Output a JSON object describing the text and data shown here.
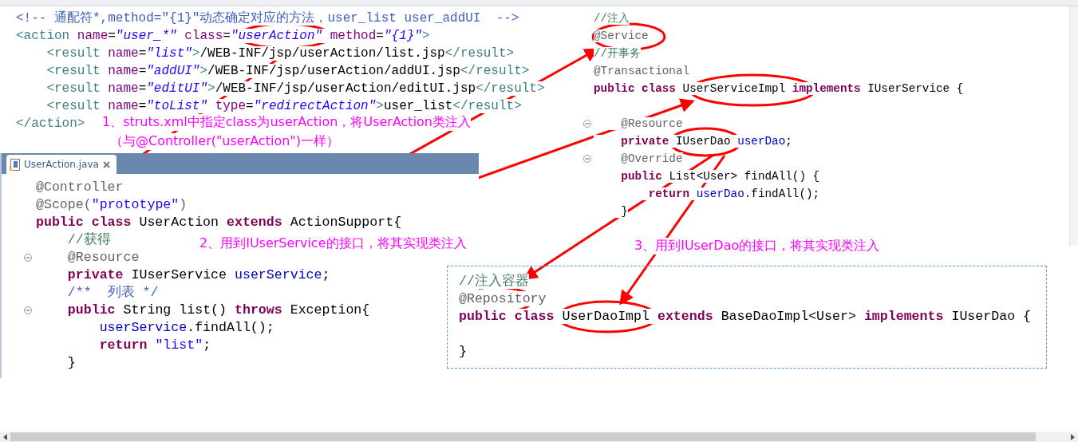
{
  "struts_snippet": {
    "lines": [
      {
        "tokens": [
          {
            "kind": "xml-comment",
            "text": "<!-- 通配符*,method=\"{1}\"动态确定对应的方法，user_list user_addUI  -->"
          }
        ]
      },
      {
        "tokens": [
          {
            "kind": "tag",
            "text": "<action"
          },
          {
            "kind": "attr",
            "text": " name"
          },
          {
            "kind": "plain",
            "text": "="
          },
          {
            "kind": "value",
            "text": "\"user_*\""
          },
          {
            "kind": "attr",
            "text": " class"
          },
          {
            "kind": "plain",
            "text": "="
          },
          {
            "kind": "value",
            "text": "\"userAction\""
          },
          {
            "kind": "attr",
            "text": " method"
          },
          {
            "kind": "plain",
            "text": "="
          },
          {
            "kind": "value",
            "text": "\"{1}\""
          },
          {
            "kind": "tag",
            "text": ">"
          }
        ]
      },
      {
        "tokens": [
          {
            "kind": "tag",
            "text": "    <result"
          },
          {
            "kind": "attr",
            "text": " name"
          },
          {
            "kind": "plain",
            "text": "="
          },
          {
            "kind": "value",
            "text": "\"list\""
          },
          {
            "kind": "tag",
            "text": ">"
          },
          {
            "kind": "plain",
            "text": "/WEB-INF/jsp/userAction/list.jsp"
          },
          {
            "kind": "tag",
            "text": "</result>"
          }
        ]
      },
      {
        "tokens": [
          {
            "kind": "tag",
            "text": "    <result"
          },
          {
            "kind": "attr",
            "text": " name"
          },
          {
            "kind": "plain",
            "text": "="
          },
          {
            "kind": "value",
            "text": "\"addUI\""
          },
          {
            "kind": "tag",
            "text": ">"
          },
          {
            "kind": "plain",
            "text": "/WEB-INF/jsp/userAction/addUI.jsp"
          },
          {
            "kind": "tag",
            "text": "</result>"
          }
        ]
      },
      {
        "tokens": [
          {
            "kind": "tag",
            "text": "    <result"
          },
          {
            "kind": "attr",
            "text": " name"
          },
          {
            "kind": "plain",
            "text": "="
          },
          {
            "kind": "value",
            "text": "\"editUI\""
          },
          {
            "kind": "tag",
            "text": ">"
          },
          {
            "kind": "plain",
            "text": "/WEB-INF/jsp/userAction/editUI.jsp"
          },
          {
            "kind": "tag",
            "text": "</result>"
          }
        ]
      },
      {
        "tokens": [
          {
            "kind": "tag",
            "text": "    <result"
          },
          {
            "kind": "attr",
            "text": " name"
          },
          {
            "kind": "plain",
            "text": "="
          },
          {
            "kind": "value",
            "text": "\"toList\""
          },
          {
            "kind": "attr",
            "text": " type"
          },
          {
            "kind": "plain",
            "text": "="
          },
          {
            "kind": "value",
            "text": "\"redirectAction\""
          },
          {
            "kind": "tag",
            "text": ">"
          },
          {
            "kind": "plain",
            "text": "user_list"
          },
          {
            "kind": "tag",
            "text": "</result>"
          }
        ]
      },
      {
        "tokens": [
          {
            "kind": "tag",
            "text": "</action>"
          }
        ]
      }
    ]
  },
  "service_snippet": {
    "lines": [
      {
        "fold": false,
        "tokens": [
          {
            "kind": "comment",
            "text": "//注入"
          }
        ]
      },
      {
        "fold": false,
        "tokens": [
          {
            "kind": "annotation",
            "text": "@Service"
          }
        ]
      },
      {
        "fold": false,
        "tokens": [
          {
            "kind": "comment",
            "text": "//开事务"
          }
        ]
      },
      {
        "fold": false,
        "tokens": [
          {
            "kind": "annotation",
            "text": "@Transactional"
          }
        ]
      },
      {
        "fold": false,
        "tokens": [
          {
            "kind": "keyword",
            "text": "public class"
          },
          {
            "kind": "plain",
            "text": " UserServiceImpl "
          },
          {
            "kind": "keyword",
            "text": "implements"
          },
          {
            "kind": "plain",
            "text": " IUserService {"
          }
        ]
      },
      {
        "fold": false
      },
      {
        "fold": true,
        "tokens": [
          {
            "kind": "annotation",
            "text": "    @Resource"
          }
        ]
      },
      {
        "fold": false,
        "tokens": [
          {
            "kind": "keyword",
            "text": "    private"
          },
          {
            "kind": "plain",
            "text": " IUserDao "
          },
          {
            "kind": "field",
            "text": "userDao"
          },
          {
            "kind": "plain",
            "text": ";"
          }
        ]
      },
      {
        "fold": true,
        "tokens": [
          {
            "kind": "annotation",
            "text": "    @Override"
          }
        ]
      },
      {
        "fold": false,
        "tokens": [
          {
            "kind": "keyword",
            "text": "    public"
          },
          {
            "kind": "plain",
            "text": " List<User> findAll() {"
          }
        ]
      },
      {
        "fold": false,
        "tokens": [
          {
            "kind": "keyword",
            "text": "        return"
          },
          {
            "kind": "field",
            "text": " userDao"
          },
          {
            "kind": "plain",
            "text": ".findAll();"
          }
        ]
      },
      {
        "fold": false,
        "tokens": [
          {
            "kind": "plain",
            "text": "    }"
          }
        ]
      }
    ]
  },
  "annotations": [
    {
      "text": "1、struts.xml中指定class为userAction，将UserAction类注入"
    },
    {
      "text": "（与@Controller(\"userAction\")一样）"
    },
    {
      "text": "2、用到IUserService的接口，将其实现类注入"
    },
    {
      "text": "3、用到IUserDao的接口，将其实现类注入"
    }
  ],
  "editor": {
    "tabs": [
      {
        "label": "UserAction.java",
        "selected": true
      }
    ],
    "lines": [
      {
        "fold": false,
        "tokens": [
          {
            "kind": "annotation",
            "text": "@Controller"
          }
        ]
      },
      {
        "fold": false,
        "tokens": [
          {
            "kind": "annotation",
            "text": "@Scope("
          },
          {
            "kind": "string",
            "text": "\"prototype\""
          },
          {
            "kind": "annotation",
            "text": ")"
          }
        ]
      },
      {
        "fold": false,
        "tokens": [
          {
            "kind": "keyword",
            "text": "public class"
          },
          {
            "kind": "plain",
            "text": " UserAction "
          },
          {
            "kind": "keyword",
            "text": "extends"
          },
          {
            "kind": "plain",
            "text": " ActionSupport{"
          }
        ]
      },
      {
        "fold": false,
        "tokens": [
          {
            "kind": "comment",
            "text": "    //获得"
          }
        ]
      },
      {
        "fold": true,
        "tokens": [
          {
            "kind": "annotation",
            "text": "    @Resource"
          }
        ]
      },
      {
        "fold": false,
        "tokens": [
          {
            "kind": "keyword",
            "text": "    private"
          },
          {
            "kind": "plain",
            "text": " IUserService "
          },
          {
            "kind": "field",
            "text": "userService"
          },
          {
            "kind": "plain",
            "text": ";"
          }
        ]
      },
      {
        "fold": false,
        "tokens": [
          {
            "kind": "javadoc",
            "text": "    /**  列表 */"
          }
        ]
      },
      {
        "fold": true,
        "tokens": [
          {
            "kind": "keyword",
            "text": "    public"
          },
          {
            "kind": "plain",
            "text": " String list() "
          },
          {
            "kind": "keyword",
            "text": "throws"
          },
          {
            "kind": "plain",
            "text": " Exception{"
          }
        ]
      },
      {
        "fold": false,
        "tokens": [
          {
            "kind": "field",
            "text": "        userService"
          },
          {
            "kind": "plain",
            "text": ".findAll();"
          }
        ]
      },
      {
        "fold": false,
        "tokens": [
          {
            "kind": "keyword",
            "text": "        return"
          },
          {
            "kind": "string",
            "text": " \"list\""
          },
          {
            "kind": "plain",
            "text": ";"
          }
        ]
      },
      {
        "fold": false,
        "tokens": [
          {
            "kind": "plain",
            "text": "    }"
          }
        ]
      }
    ]
  },
  "dao_snippet": {
    "lines": [
      {
        "tokens": [
          {
            "kind": "comment",
            "text": "//注入容器"
          }
        ]
      },
      {
        "tokens": [
          {
            "kind": "annotation",
            "text": "@Repository"
          }
        ]
      },
      {
        "tokens": [
          {
            "kind": "keyword",
            "text": "public class"
          },
          {
            "kind": "plain",
            "text": " UserDaoImpl "
          },
          {
            "kind": "keyword",
            "text": "extends"
          },
          {
            "kind": "plain",
            "text": " BaseDaoImpl<User> "
          },
          {
            "kind": "keyword",
            "text": "implements"
          },
          {
            "kind": "plain",
            "text": " IUserDao {"
          }
        ]
      },
      {
        "tokens": [
          {
            "kind": "plain",
            "text": "}"
          }
        ]
      }
    ]
  }
}
